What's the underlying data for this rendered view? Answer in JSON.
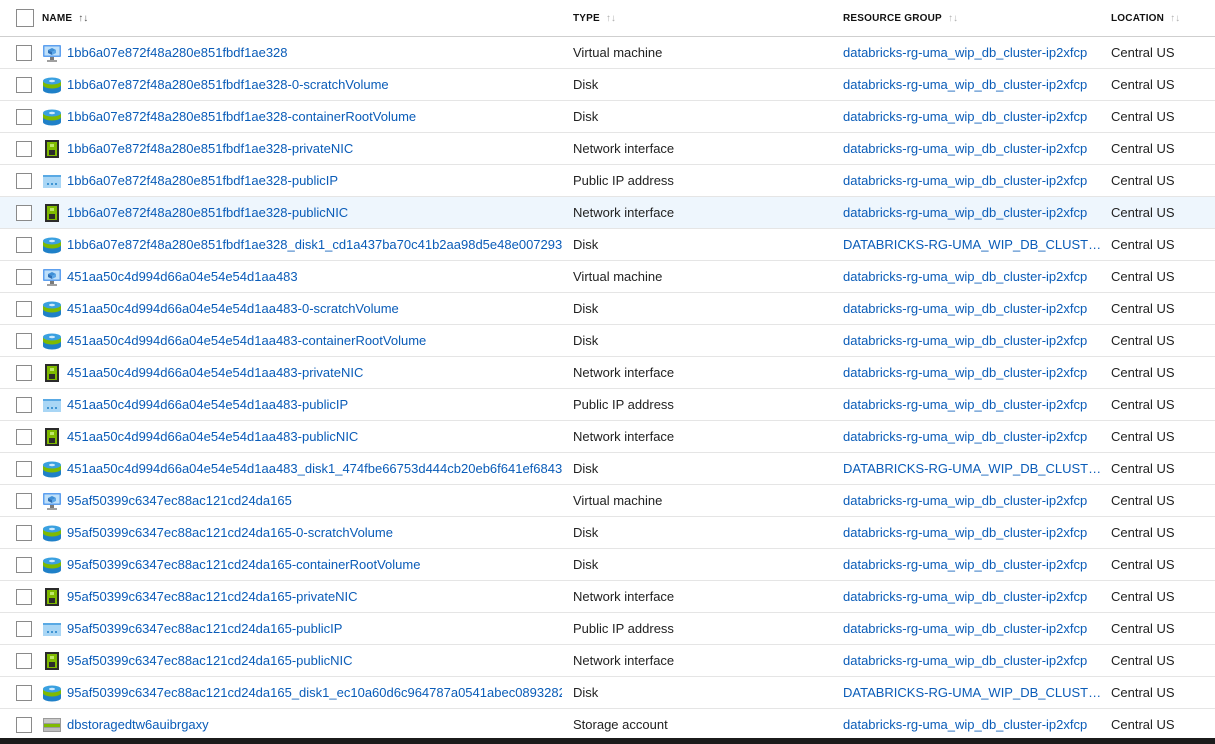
{
  "columns": {
    "name": "NAME",
    "type": "TYPE",
    "resource_group": "RESOURCE GROUP",
    "location": "LOCATION"
  },
  "sort_icon": "↑↓",
  "colors": {
    "link": "#0a5cb8",
    "selected_row": "#eef6fd"
  },
  "rows": [
    {
      "name": "1bb6a07e872f48a280e851fbdf1ae328",
      "type": "Virtual machine",
      "rg": "databricks-rg-uma_wip_db_cluster-ip2xfcp",
      "location": "Central US",
      "icon": "vm-icon"
    },
    {
      "name": "1bb6a07e872f48a280e851fbdf1ae328-0-scratchVolume",
      "type": "Disk",
      "rg": "databricks-rg-uma_wip_db_cluster-ip2xfcp",
      "location": "Central US",
      "icon": "disk-icon"
    },
    {
      "name": "1bb6a07e872f48a280e851fbdf1ae328-containerRootVolume",
      "type": "Disk",
      "rg": "databricks-rg-uma_wip_db_cluster-ip2xfcp",
      "location": "Central US",
      "icon": "disk-icon"
    },
    {
      "name": "1bb6a07e872f48a280e851fbdf1ae328-privateNIC",
      "type": "Network interface",
      "rg": "databricks-rg-uma_wip_db_cluster-ip2xfcp",
      "location": "Central US",
      "icon": "nic-icon"
    },
    {
      "name": "1bb6a07e872f48a280e851fbdf1ae328-publicIP",
      "type": "Public IP address",
      "rg": "databricks-rg-uma_wip_db_cluster-ip2xfcp",
      "location": "Central US",
      "icon": "public-ip-icon"
    },
    {
      "name": "1bb6a07e872f48a280e851fbdf1ae328-publicNIC",
      "type": "Network interface",
      "rg": "databricks-rg-uma_wip_db_cluster-ip2xfcp",
      "location": "Central US",
      "icon": "nic-icon",
      "selected": true
    },
    {
      "name": "1bb6a07e872f48a280e851fbdf1ae328_disk1_cd1a437ba70c41b2aa98d5e48e007293",
      "type": "Disk",
      "rg": "DATABRICKS-RG-UMA_WIP_DB_CLUSTER-",
      "location": "Central US",
      "icon": "disk-icon"
    },
    {
      "name": "451aa50c4d994d66a04e54e54d1aa483",
      "type": "Virtual machine",
      "rg": "databricks-rg-uma_wip_db_cluster-ip2xfcp",
      "location": "Central US",
      "icon": "vm-icon"
    },
    {
      "name": "451aa50c4d994d66a04e54e54d1aa483-0-scratchVolume",
      "type": "Disk",
      "rg": "databricks-rg-uma_wip_db_cluster-ip2xfcp",
      "location": "Central US",
      "icon": "disk-icon"
    },
    {
      "name": "451aa50c4d994d66a04e54e54d1aa483-containerRootVolume",
      "type": "Disk",
      "rg": "databricks-rg-uma_wip_db_cluster-ip2xfcp",
      "location": "Central US",
      "icon": "disk-icon"
    },
    {
      "name": "451aa50c4d994d66a04e54e54d1aa483-privateNIC",
      "type": "Network interface",
      "rg": "databricks-rg-uma_wip_db_cluster-ip2xfcp",
      "location": "Central US",
      "icon": "nic-icon"
    },
    {
      "name": "451aa50c4d994d66a04e54e54d1aa483-publicIP",
      "type": "Public IP address",
      "rg": "databricks-rg-uma_wip_db_cluster-ip2xfcp",
      "location": "Central US",
      "icon": "public-ip-icon"
    },
    {
      "name": "451aa50c4d994d66a04e54e54d1aa483-publicNIC",
      "type": "Network interface",
      "rg": "databricks-rg-uma_wip_db_cluster-ip2xfcp",
      "location": "Central US",
      "icon": "nic-icon"
    },
    {
      "name": "451aa50c4d994d66a04e54e54d1aa483_disk1_474fbe66753d444cb20eb6f641ef6843",
      "type": "Disk",
      "rg": "DATABRICKS-RG-UMA_WIP_DB_CLUSTER-",
      "location": "Central US",
      "icon": "disk-icon"
    },
    {
      "name": "95af50399c6347ec88ac121cd24da165",
      "type": "Virtual machine",
      "rg": "databricks-rg-uma_wip_db_cluster-ip2xfcp",
      "location": "Central US",
      "icon": "vm-icon"
    },
    {
      "name": "95af50399c6347ec88ac121cd24da165-0-scratchVolume",
      "type": "Disk",
      "rg": "databricks-rg-uma_wip_db_cluster-ip2xfcp",
      "location": "Central US",
      "icon": "disk-icon"
    },
    {
      "name": "95af50399c6347ec88ac121cd24da165-containerRootVolume",
      "type": "Disk",
      "rg": "databricks-rg-uma_wip_db_cluster-ip2xfcp",
      "location": "Central US",
      "icon": "disk-icon"
    },
    {
      "name": "95af50399c6347ec88ac121cd24da165-privateNIC",
      "type": "Network interface",
      "rg": "databricks-rg-uma_wip_db_cluster-ip2xfcp",
      "location": "Central US",
      "icon": "nic-icon"
    },
    {
      "name": "95af50399c6347ec88ac121cd24da165-publicIP",
      "type": "Public IP address",
      "rg": "databricks-rg-uma_wip_db_cluster-ip2xfcp",
      "location": "Central US",
      "icon": "public-ip-icon"
    },
    {
      "name": "95af50399c6347ec88ac121cd24da165-publicNIC",
      "type": "Network interface",
      "rg": "databricks-rg-uma_wip_db_cluster-ip2xfcp",
      "location": "Central US",
      "icon": "nic-icon"
    },
    {
      "name": "95af50399c6347ec88ac121cd24da165_disk1_ec10a60d6c964787a0541abec0893282",
      "type": "Disk",
      "rg": "DATABRICKS-RG-UMA_WIP_DB_CLUSTER-",
      "location": "Central US",
      "icon": "disk-icon"
    },
    {
      "name": "dbstoragedtw6auibrgaxy",
      "type": "Storage account",
      "rg": "databricks-rg-uma_wip_db_cluster-ip2xfcp",
      "location": "Central US",
      "icon": "storage-icon"
    }
  ]
}
